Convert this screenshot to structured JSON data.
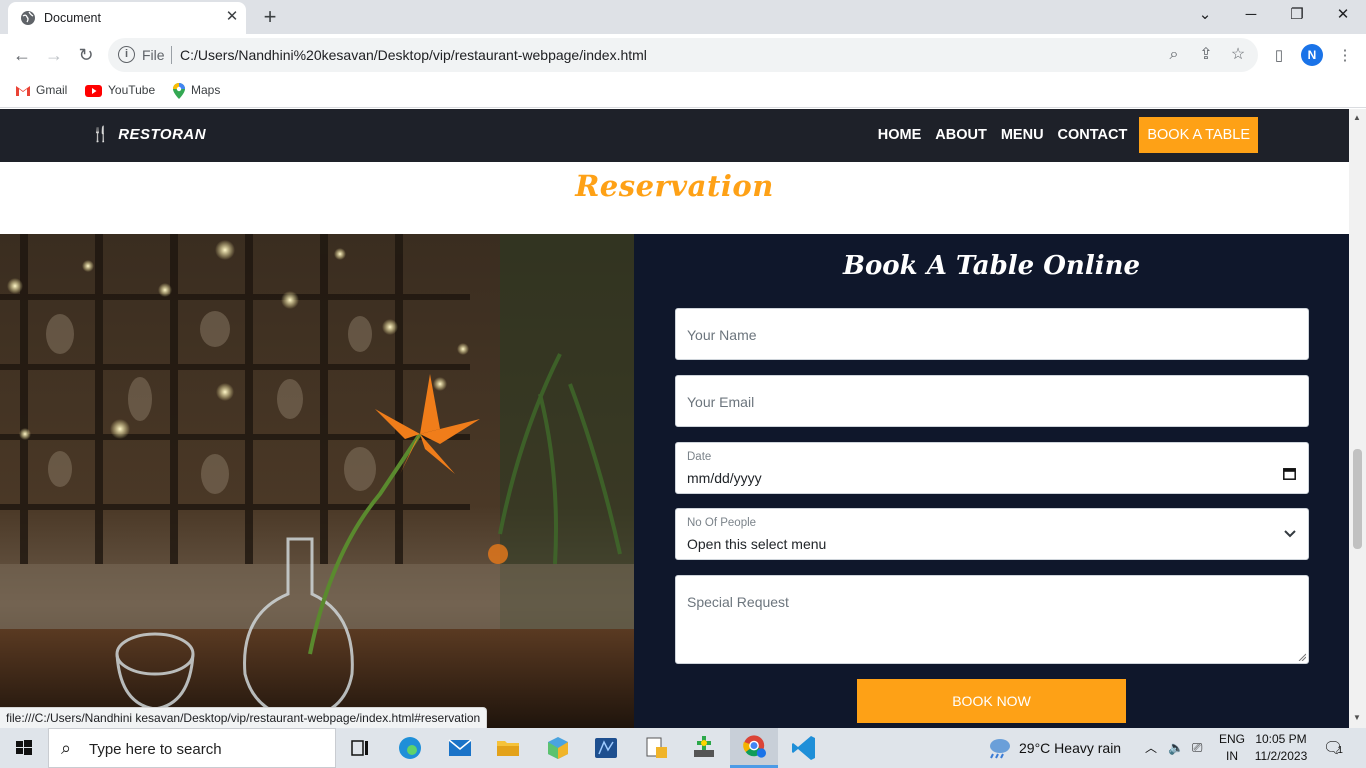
{
  "browser": {
    "tab_title": "Document",
    "scheme": "File",
    "url": "C:/Users/Nandhini%20kesavan/Desktop/vip/restaurant-webpage/index.html",
    "bookmarks": [
      {
        "label": "Gmail"
      },
      {
        "label": "YouTube"
      },
      {
        "label": "Maps"
      }
    ],
    "profile_initial": "N",
    "status_url": "file:///C:/Users/Nandhini kesavan/Desktop/vip/restaurant-webpage/index.html#reservation"
  },
  "site": {
    "brand": "RESTORAN",
    "nav": [
      {
        "label": "HOME"
      },
      {
        "label": "ABOUT"
      },
      {
        "label": "MENU"
      },
      {
        "label": "CONTACT"
      },
      {
        "label": "BOOK A TABLE"
      }
    ],
    "section_title": "Reservation",
    "form": {
      "title": "Book A Table Online",
      "name_placeholder": "Your Name",
      "email_placeholder": "Your Email",
      "date_label": "Date",
      "date_value": "mm/dd/yyyy",
      "people_label": "No Of People",
      "people_value": "Open this select menu",
      "request_placeholder": "Special Request",
      "submit_label": "BOOK NOW"
    },
    "accent_color": "#fea116",
    "panel_color": "#0f172b"
  },
  "taskbar": {
    "search_placeholder": "Type here to search",
    "weather": "29°C  Heavy rain",
    "lang_top": "ENG",
    "lang_bottom": "IN",
    "time": "10:05 PM",
    "date": "11/2/2023",
    "notification_count": "1"
  }
}
